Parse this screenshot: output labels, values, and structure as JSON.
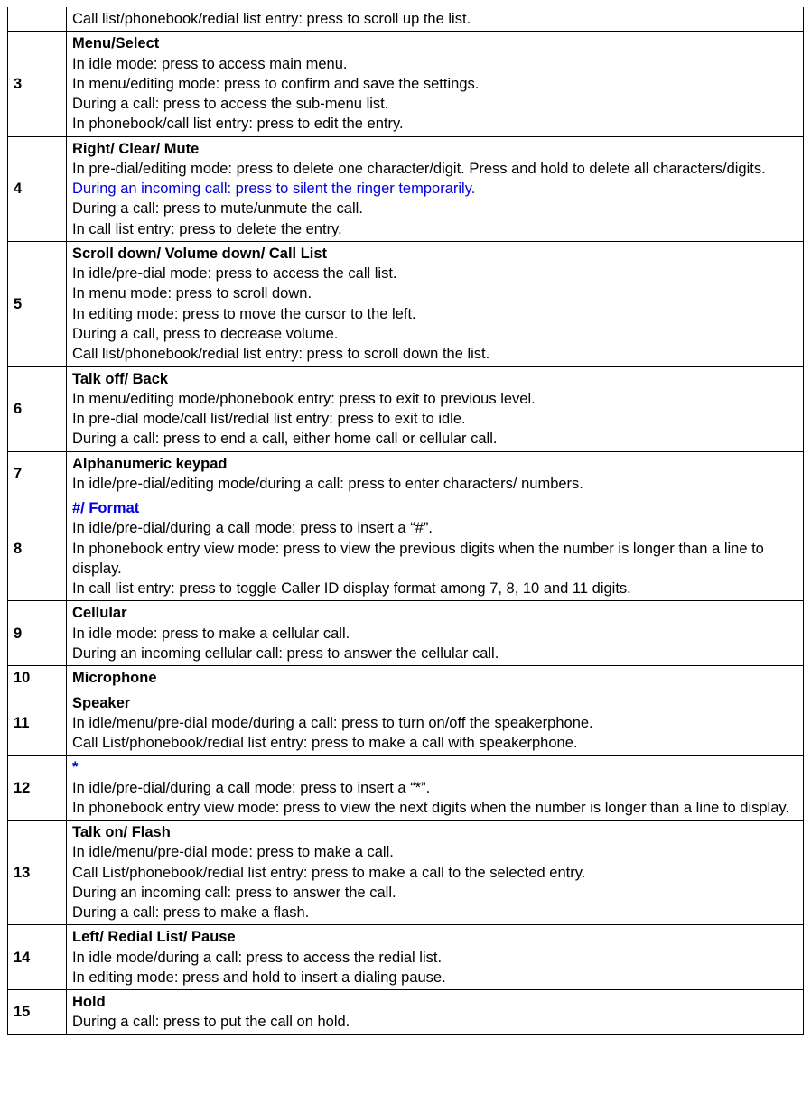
{
  "rows": [
    {
      "num": "",
      "lines": [
        {
          "text": "Call list/phonebook/redial list entry: press to scroll up the list."
        }
      ],
      "first": true
    },
    {
      "num": "3",
      "lines": [
        {
          "text": "Menu/Select",
          "bold": true
        },
        {
          "text": "In idle mode: press to access main menu."
        },
        {
          "text": "In menu/editing mode: press to confirm and save the settings."
        },
        {
          "text": "During a call: press to access the sub-menu list."
        },
        {
          "text": "In phonebook/call list entry: press to edit the entry."
        }
      ]
    },
    {
      "num": "4",
      "lines": [
        {
          "text": "Right/ Clear/ Mute",
          "bold": true
        },
        {
          "text": "In pre-dial/editing mode: press to delete one character/digit. Press and hold to delete all characters/digits."
        },
        {
          "text": "During an incoming call: press to silent the ringer temporarily.",
          "blue": true
        },
        {
          "text": "During a call: press to mute/unmute the call."
        },
        {
          "text": "In call list entry: press to delete the entry."
        }
      ]
    },
    {
      "num": "5",
      "lines": [
        {
          "text": "Scroll down/ Volume down/ Call List",
          "bold": true
        },
        {
          "text": "In idle/pre-dial mode: press to access the call list."
        },
        {
          "text": "In menu mode: press to scroll down."
        },
        {
          "text": "In editing mode: press to move the cursor to the left."
        },
        {
          "text": "During a call, press to decrease volume."
        },
        {
          "text": "Call list/phonebook/redial list entry: press to scroll down the list."
        }
      ]
    },
    {
      "num": "6",
      "lines": [
        {
          "text": "Talk off/ Back",
          "bold": true
        },
        {
          "text": "In menu/editing mode/phonebook entry: press to exit to previous level."
        },
        {
          "text": "In pre-dial mode/call list/redial list entry: press to exit to idle."
        },
        {
          "text": "During a call: press to end a call, either home call or cellular call."
        }
      ]
    },
    {
      "num": "7",
      "lines": [
        {
          "text": "Alphanumeric keypad",
          "bold": true
        },
        {
          "text": "In idle/pre-dial/editing mode/during a call: press to enter characters/ numbers."
        }
      ]
    },
    {
      "num": "8",
      "lines": [
        {
          "text": "#/ Format",
          "bold": true,
          "blue": true
        },
        {
          "text": "In idle/pre-dial/during a call mode: press to insert a “#”."
        },
        {
          "text": "In phonebook entry view mode: press to view the previous digits when the number is longer than a line to display."
        },
        {
          "text": "In call list entry: press to toggle Caller ID display format among 7, 8, 10 and 11 digits."
        }
      ]
    },
    {
      "num": "9",
      "lines": [
        {
          "text": "Cellular",
          "bold": true
        },
        {
          "text": "In idle mode: press to make a cellular call."
        },
        {
          "text": "During an incoming cellular call: press to answer the cellular call."
        }
      ]
    },
    {
      "num": "10",
      "lines": [
        {
          "text": "Microphone",
          "bold": true
        }
      ]
    },
    {
      "num": "11",
      "lines": [
        {
          "text": "Speaker",
          "bold": true
        },
        {
          "text": "In idle/menu/pre-dial mode/during a call: press to turn on/off the speakerphone."
        },
        {
          "text": "Call List/phonebook/redial list entry: press to make a call with speakerphone."
        }
      ]
    },
    {
      "num": "12",
      "lines": [
        {
          "text": "*",
          "bold": true,
          "blue": true
        },
        {
          "text": "In idle/pre-dial/during a call mode: press to insert a “*”."
        },
        {
          "text": "In phonebook entry view mode: press to view the next digits when the number is longer than a line to display."
        }
      ]
    },
    {
      "num": "13",
      "lines": [
        {
          "text": "Talk on/ Flash",
          "bold": true
        },
        {
          "text": "In idle/menu/pre-dial mode: press to make a call."
        },
        {
          "text": "Call List/phonebook/redial list entry: press to make a call to the selected entry."
        },
        {
          "text": "During an incoming call: press to answer the call."
        },
        {
          "text": "During a call: press to make a flash."
        }
      ]
    },
    {
      "num": "14",
      "lines": [
        {
          "text": "Left/ Redial List/ Pause",
          "bold": true
        },
        {
          "text": "In idle mode/during a call: press to access the redial list."
        },
        {
          "text": "In editing mode: press and hold to insert a dialing pause."
        }
      ]
    },
    {
      "num": "15",
      "lines": [
        {
          "text": "Hold",
          "bold": true
        },
        {
          "text": "During a call: press to put the call on hold."
        }
      ]
    }
  ]
}
